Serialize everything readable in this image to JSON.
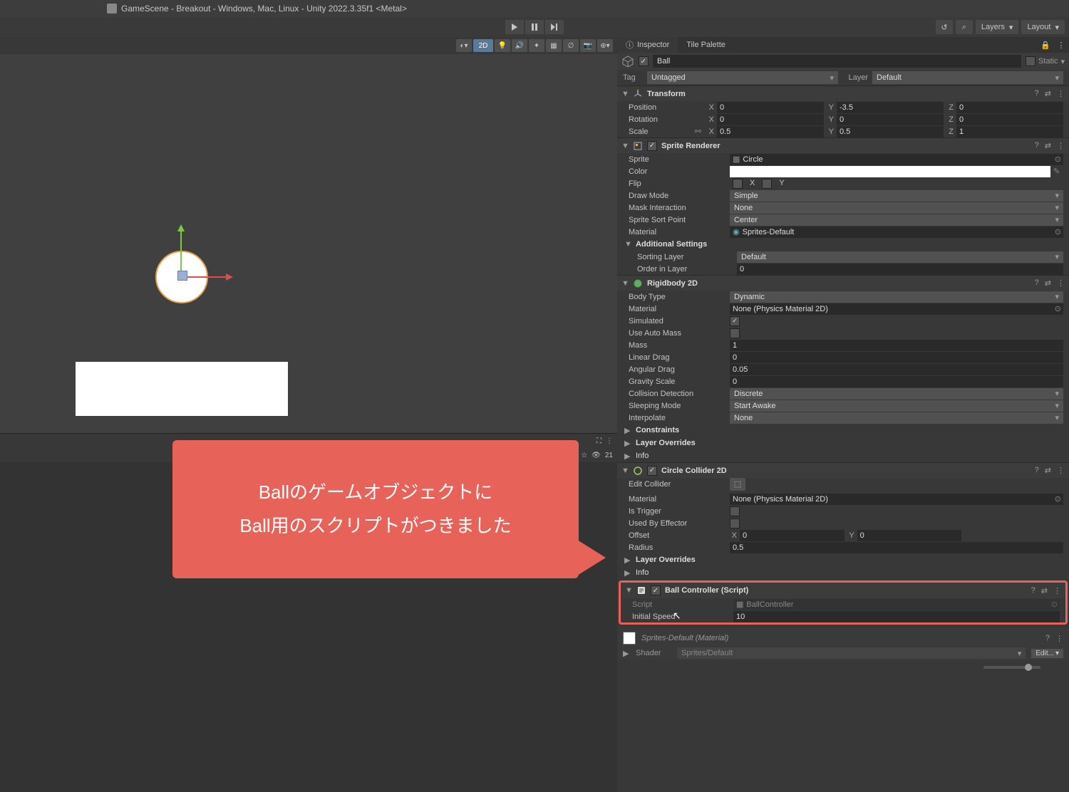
{
  "window_title": "GameScene - Breakout - Windows, Mac, Linux - Unity 2022.3.35f1 <Metal>",
  "toolbar": {
    "layers": "Layers",
    "layout": "Layout"
  },
  "scene_toolbar": {
    "mode_2d": "2D"
  },
  "game_bar": {
    "count": "21"
  },
  "tabs": {
    "inspector": "Inspector",
    "tile_palette": "Tile Palette"
  },
  "object": {
    "name": "Ball",
    "static_label": "Static"
  },
  "tag_row": {
    "tag_label": "Tag",
    "tag_value": "Untagged",
    "layer_label": "Layer",
    "layer_value": "Default"
  },
  "transform": {
    "title": "Transform",
    "position_label": "Position",
    "pos_x": "0",
    "pos_y": "-3.5",
    "pos_z": "0",
    "rotation_label": "Rotation",
    "rot_x": "0",
    "rot_y": "0",
    "rot_z": "0",
    "scale_label": "Scale",
    "scl_x": "0.5",
    "scl_y": "0.5",
    "scl_z": "1"
  },
  "sprite_renderer": {
    "title": "Sprite Renderer",
    "sprite_label": "Sprite",
    "sprite_value": "Circle",
    "color_label": "Color",
    "flip_label": "Flip",
    "flip_x": "X",
    "flip_y": "Y",
    "draw_mode_label": "Draw Mode",
    "draw_mode_value": "Simple",
    "mask_label": "Mask Interaction",
    "mask_value": "None",
    "sort_label": "Sprite Sort Point",
    "sort_value": "Center",
    "material_label": "Material",
    "material_value": "Sprites-Default",
    "additional_label": "Additional Settings",
    "sorting_layer_label": "Sorting Layer",
    "sorting_layer_value": "Default",
    "order_label": "Order in Layer",
    "order_value": "0"
  },
  "rigidbody": {
    "title": "Rigidbody 2D",
    "body_type_label": "Body Type",
    "body_type_value": "Dynamic",
    "material_label": "Material",
    "material_value": "None (Physics Material 2D)",
    "simulated_label": "Simulated",
    "auto_mass_label": "Use Auto Mass",
    "mass_label": "Mass",
    "mass_value": "1",
    "linear_drag_label": "Linear Drag",
    "linear_drag_value": "0",
    "angular_drag_label": "Angular Drag",
    "angular_drag_value": "0.05",
    "gravity_label": "Gravity Scale",
    "gravity_value": "0",
    "collision_label": "Collision Detection",
    "collision_value": "Discrete",
    "sleeping_label": "Sleeping Mode",
    "sleeping_value": "Start Awake",
    "interpolate_label": "Interpolate",
    "interpolate_value": "None",
    "constraints_label": "Constraints",
    "layer_overrides_label": "Layer Overrides",
    "info_label": "Info"
  },
  "circle_collider": {
    "title": "Circle Collider 2D",
    "edit_label": "Edit Collider",
    "material_label": "Material",
    "material_value": "None (Physics Material 2D)",
    "trigger_label": "Is Trigger",
    "effector_label": "Used By Effector",
    "offset_label": "Offset",
    "off_x": "0",
    "off_y": "0",
    "radius_label": "Radius",
    "radius_value": "0.5",
    "layer_overrides_label": "Layer Overrides",
    "info_label": "Info"
  },
  "ball_controller": {
    "title": "Ball Controller (Script)",
    "script_label": "Script",
    "script_value": "BallController",
    "speed_label": "Initial Speed",
    "speed_value": "10"
  },
  "material_footer": {
    "name": "Sprites-Default (Material)",
    "shader_label": "Shader",
    "shader_value": "Sprites/Default",
    "edit_btn": "Edit..."
  },
  "callout": {
    "line1": "Ballのゲームオブジェクトに",
    "line2": "Ball用のスクリプトがつきました"
  }
}
